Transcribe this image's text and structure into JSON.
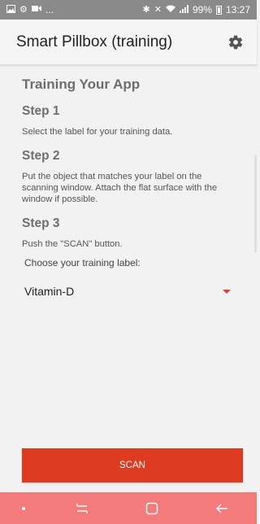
{
  "status_bar": {
    "left_icons": [
      "gallery-icon",
      "settings-icon",
      "video-icon"
    ],
    "more": "...",
    "battery": "99%",
    "time": "13:27"
  },
  "app_bar": {
    "title": "Smart Pillbox (training)"
  },
  "content": {
    "heading": "Training Your App",
    "steps": [
      {
        "title": "Step 1",
        "text": "Select the label for your training data."
      },
      {
        "title": "Step 2",
        "text": "Put the object that matches your label on the scanning window. Attach the flat surface with the window if possible."
      },
      {
        "title": "Step 3",
        "text": "Push the \"SCAN\" button."
      }
    ],
    "choose_label": "Choose your training label:",
    "selected_label": "Vitamin-D"
  },
  "scan_button": {
    "label": "SCAN"
  },
  "colors": {
    "accent": "#dd3a22",
    "nav_bar": "#f37b7b",
    "status_bar": "#8a8a8a"
  }
}
